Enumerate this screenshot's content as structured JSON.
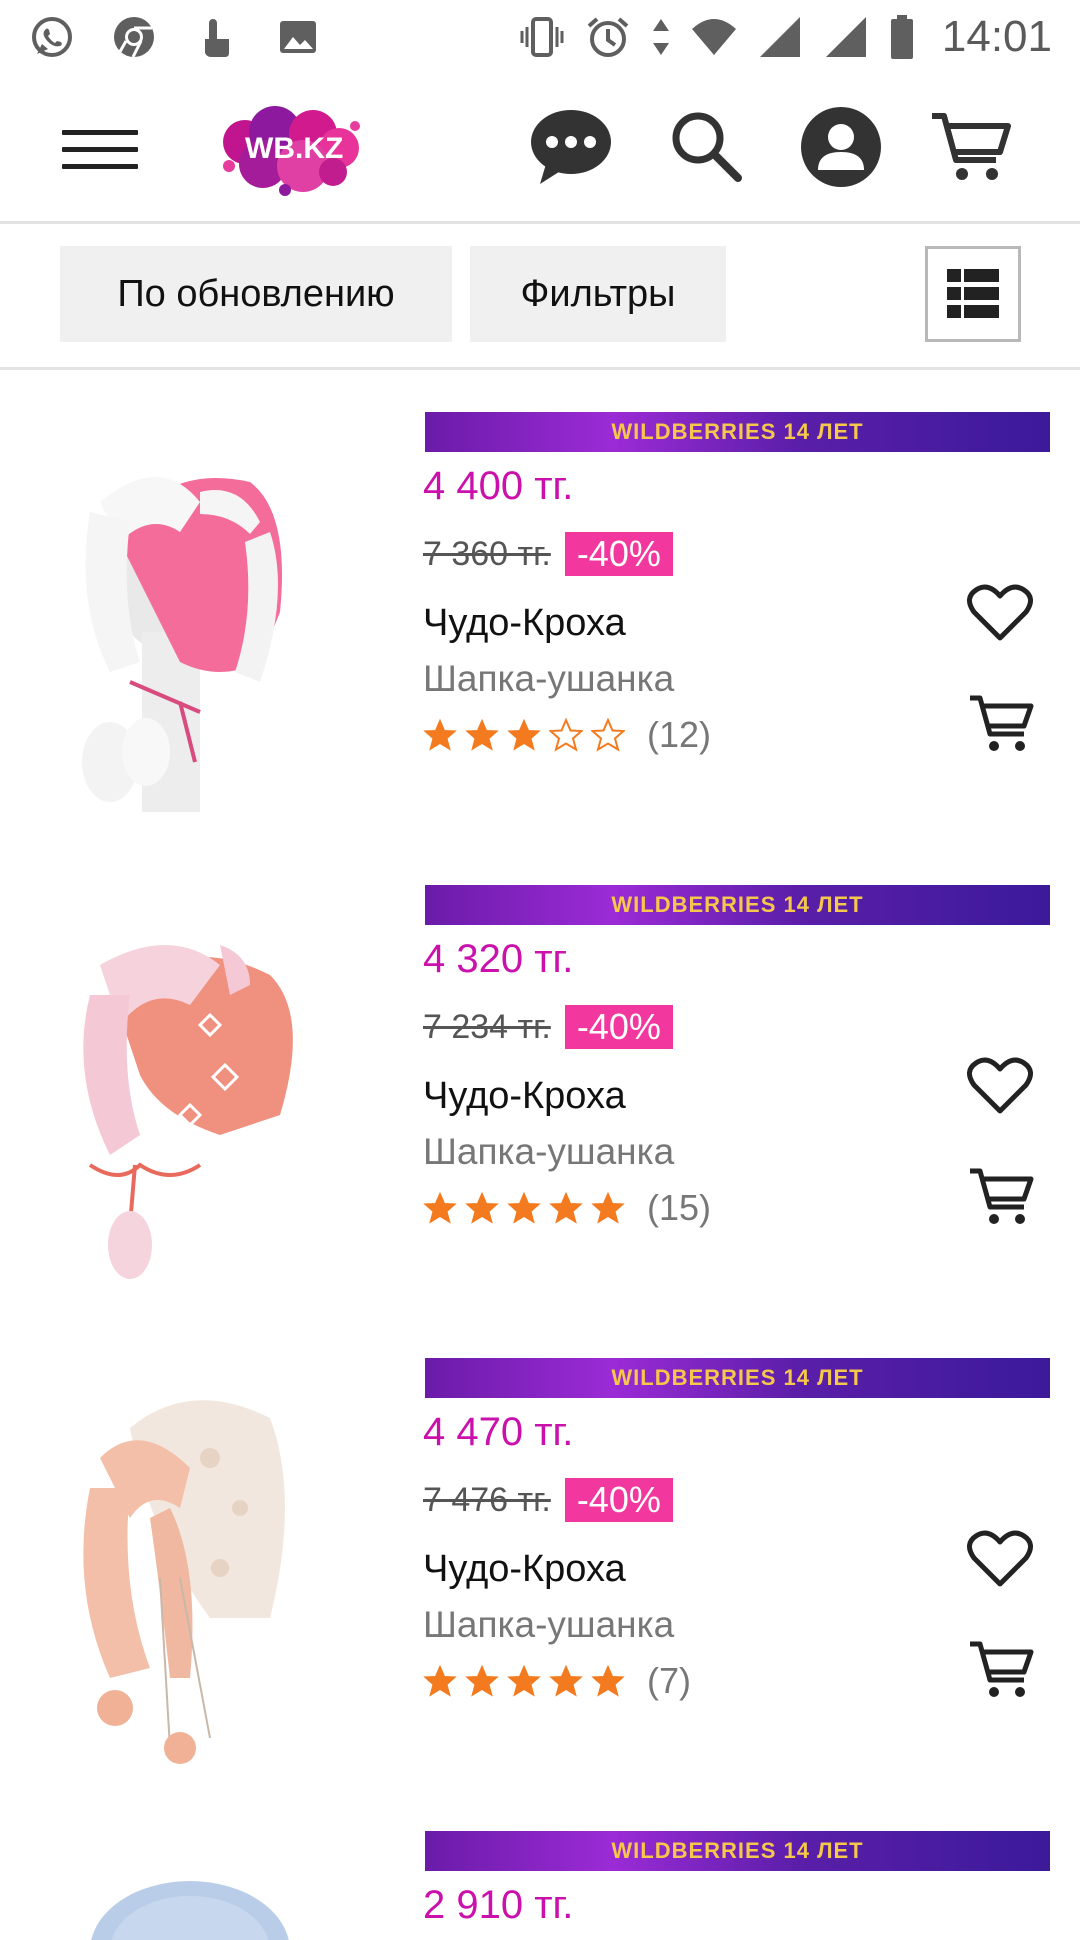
{
  "status_bar": {
    "time": "14:01",
    "left_icons": [
      "whatsapp-icon",
      "chrome-icon",
      "touch-icon",
      "image-icon"
    ],
    "right_icons": [
      "vibrate-icon",
      "alarm-icon",
      "data-arrows-icon",
      "wifi-icon",
      "signal-icon",
      "signal-icon",
      "battery-icon"
    ]
  },
  "header": {
    "logo_text": "WB.KZ",
    "brand_colors": {
      "primary": "#cb11ab",
      "secondary": "#9b2bd6",
      "accent": "#f2389e"
    }
  },
  "toolbar": {
    "sort_label": "По обновлению",
    "filter_label": "Фильтры"
  },
  "products": [
    {
      "promo": "WILDBERRIES 14 ЛЕТ",
      "price": "4 400 тг.",
      "old_price": "7 360 тг.",
      "discount": "-40%",
      "brand": "Чудо-Кроха",
      "name": "Шапка-ушанка",
      "rating": 3,
      "reviews": "(12)",
      "image_colors": {
        "main": "#f46c9a",
        "fur": "#f7f7f7"
      }
    },
    {
      "promo": "WILDBERRIES 14 ЛЕТ",
      "price": "4 320 тг.",
      "old_price": "7 234 тг.",
      "discount": "-40%",
      "brand": "Чудо-Кроха",
      "name": "Шапка-ушанка",
      "rating": 5,
      "reviews": "(15)",
      "image_colors": {
        "main": "#f0907e",
        "fur": "#f6d2dc"
      }
    },
    {
      "promo": "WILDBERRIES 14 ЛЕТ",
      "price": "4 470 тг.",
      "old_price": "7 476 тг.",
      "discount": "-40%",
      "brand": "Чудо-Кроха",
      "name": "Шапка-ушанка",
      "rating": 5,
      "reviews": "(7)",
      "image_colors": {
        "main": "#f1e7df",
        "fur": "#f3bfa8"
      }
    },
    {
      "promo": "WILDBERRIES 14 ЛЕТ",
      "price": "2 910 тг."
    }
  ]
}
